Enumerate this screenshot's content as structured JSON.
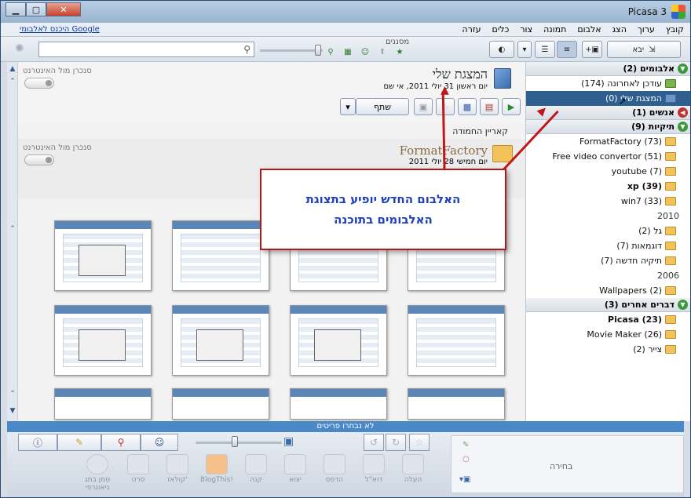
{
  "app": {
    "title": "Picasa 3"
  },
  "menu": {
    "items": [
      "קובץ",
      "ערוך",
      "הצג",
      "אלבום",
      "תמונה",
      "צור",
      "כלים",
      "עזרה"
    ],
    "signin_link": "היכנס לאלבומי Google"
  },
  "toolbar": {
    "import_label": "יבא",
    "filters_label": "מסננים",
    "search_placeholder": ""
  },
  "sidebar": {
    "albums_header": "אלבומים (2)",
    "albums": [
      {
        "label": "עודכן לאחרונה (174)"
      },
      {
        "label": "המצגת שלי (0)",
        "selected": true
      }
    ],
    "people_header": "אנשים (1)",
    "folders_header": "תיקיות (9)",
    "folders": [
      {
        "label": "FormatFactory (73)"
      },
      {
        "label": "Free video convertor (51)"
      },
      {
        "label": "youtube (7)"
      },
      {
        "label": "xp (39)",
        "bold": true
      },
      {
        "label": "win7 (33)"
      }
    ],
    "year_2010": "2010",
    "folders_2010": [
      {
        "label": "גל (2)"
      },
      {
        "label": "דוגמאות (7)"
      },
      {
        "label": "תיקיה חדשה (7)"
      }
    ],
    "year_2006": "2006",
    "folders_2006": [
      {
        "label": "Wallpapers (2)"
      }
    ],
    "other_header": "דברים אחרים (3)",
    "other": [
      {
        "label": "Picasa (23)",
        "bold": true
      },
      {
        "label": "Movie Maker (26)"
      },
      {
        "label": "צייר (2)"
      }
    ]
  },
  "album": {
    "title": "המצגת שלי",
    "date": "יום ראשון 31 יולי 2011, אי שם",
    "share_label": "שתף",
    "sync_label": "סנכרן מול האינטרנט",
    "caption": "קאריין החמודה"
  },
  "folder": {
    "title": "FormatFactory",
    "date": "יום חמישי 28 יולי 2011",
    "sync_label": "סנכרן מול האינטרנט"
  },
  "callout": {
    "text": "האלבום החדש יופיע בתצוגת האלבומים בתוכנה"
  },
  "status": {
    "text": "לא נבחרו פריטים"
  },
  "bottom_tools": [
    "העלה",
    "דוא\"ל",
    "הדפס",
    "יצוא",
    "קנה",
    "BlogThis!",
    "קולאז'",
    "סרט",
    "סמן בתג גיאוגרפי"
  ],
  "selection": {
    "label": "בחירה"
  },
  "colors": {
    "accent": "#2f5f8f",
    "callout_border": "#b01a1a",
    "callout_text": "#1e3fbf"
  }
}
